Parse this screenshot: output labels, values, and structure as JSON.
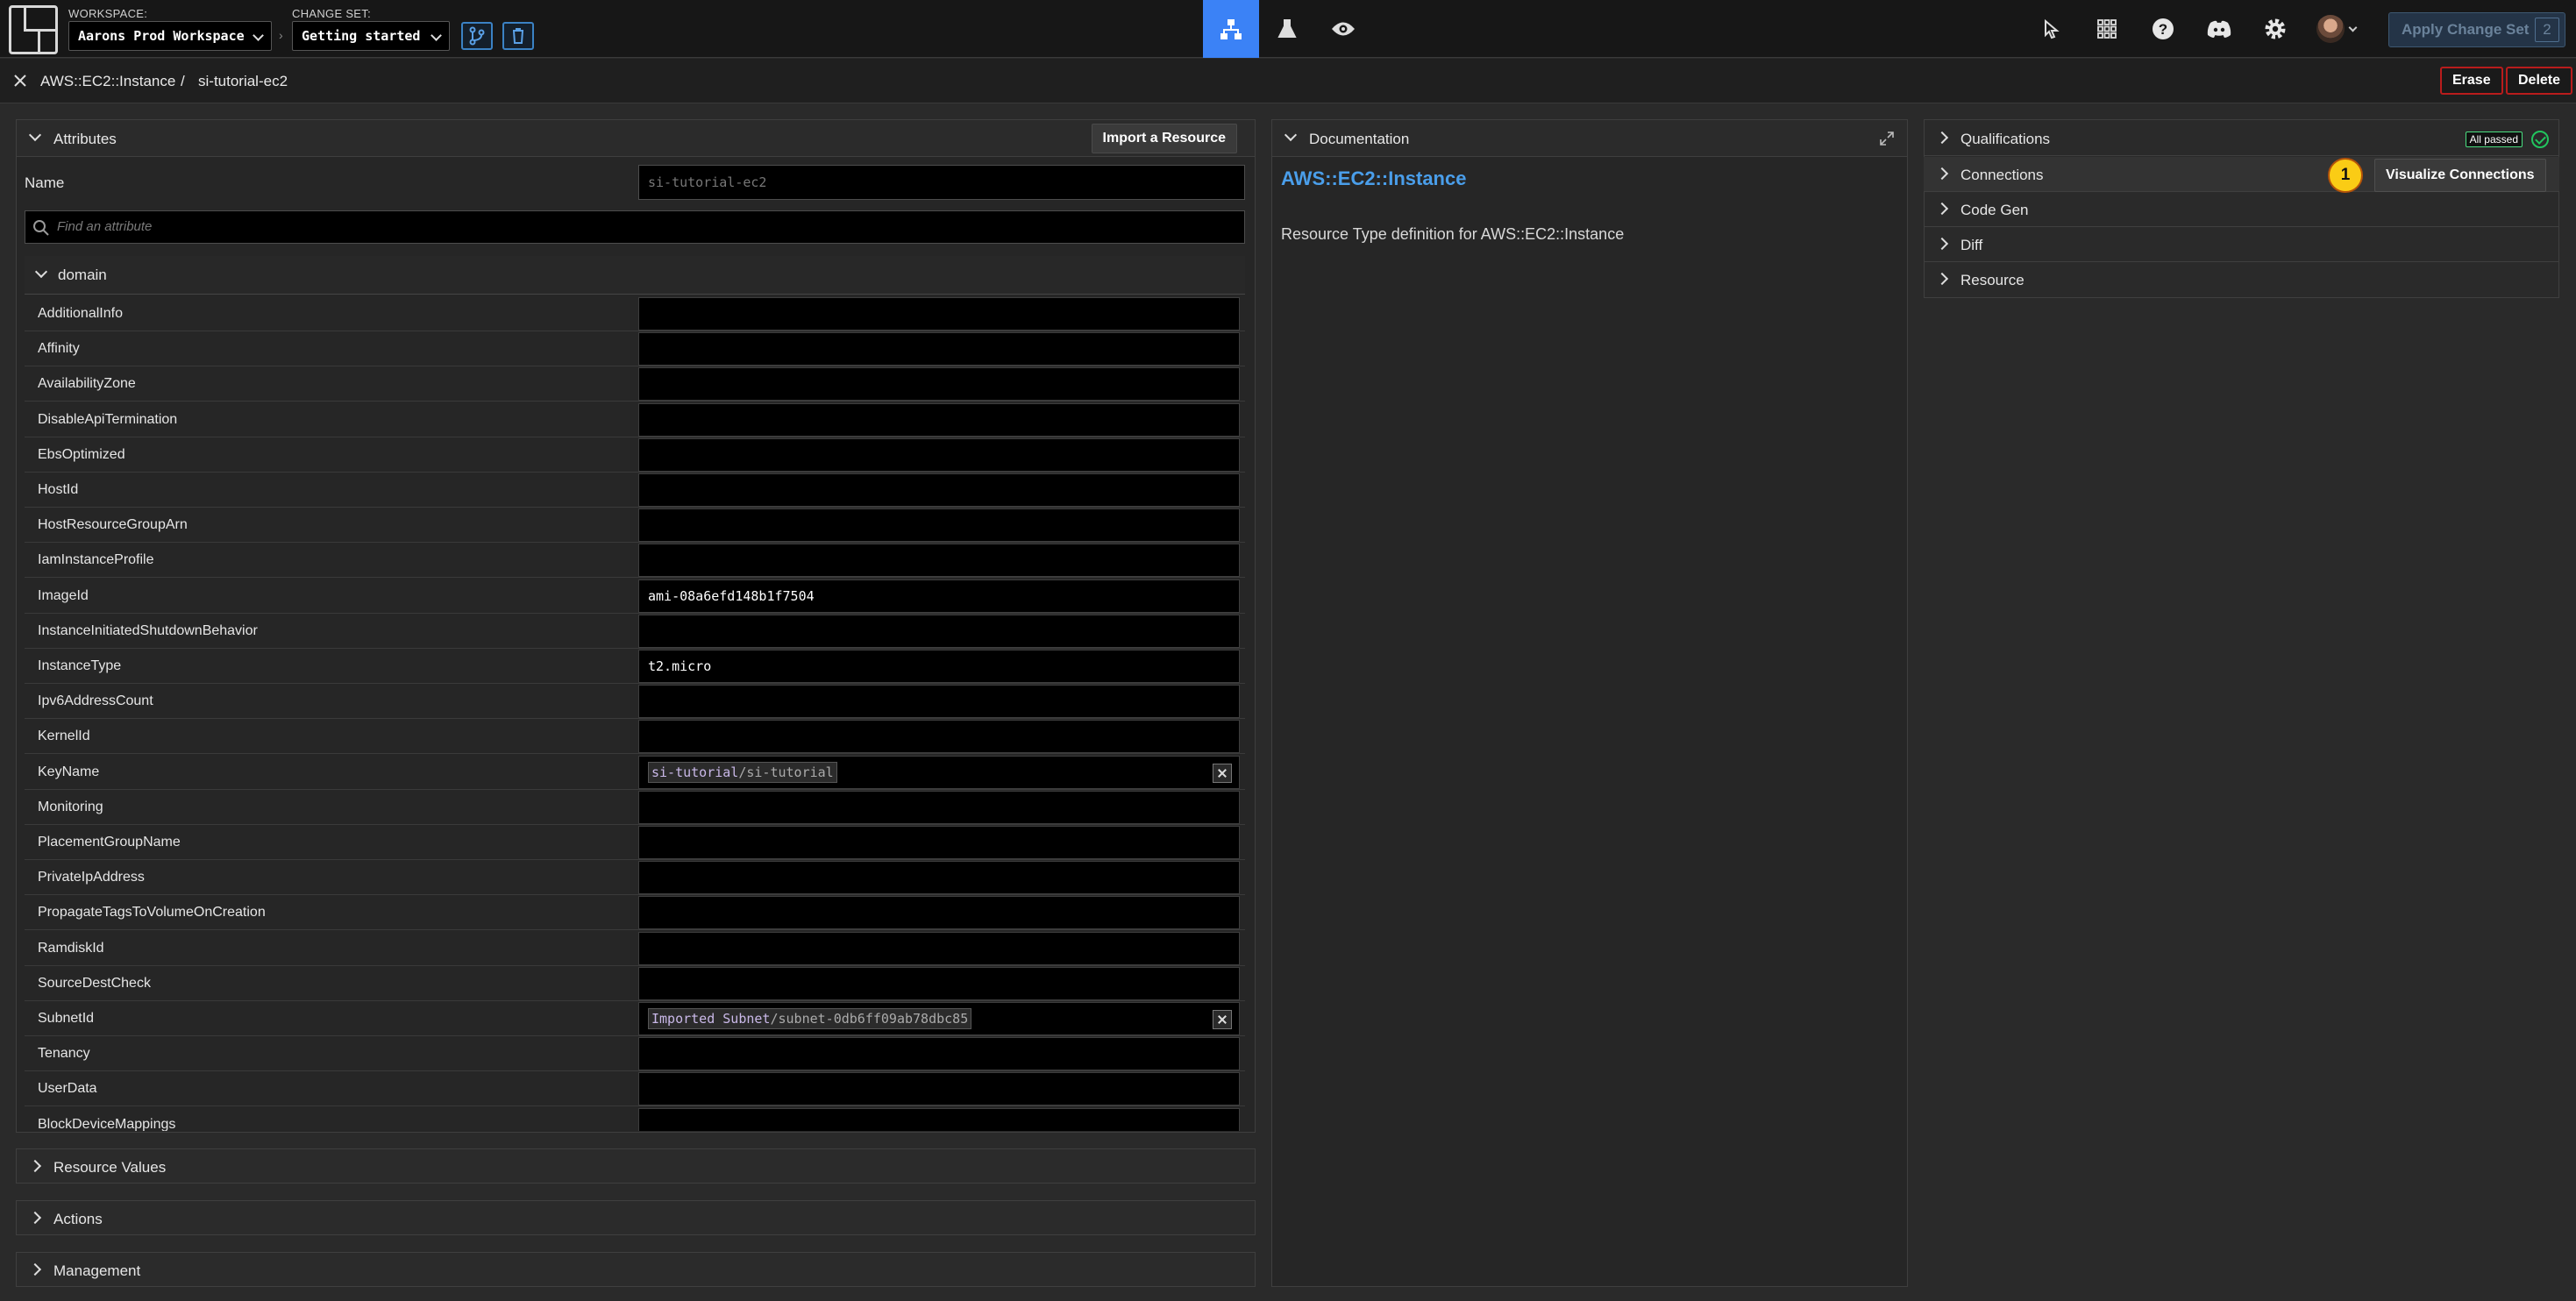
{
  "topbar": {
    "workspace_label": "WORKSPACE:",
    "workspace_value": "Aarons Prod Workspace",
    "changeset_label": "CHANGE SET:",
    "changeset_value": "Getting started",
    "apply_label": "Apply Change Set",
    "apply_count": "2"
  },
  "breadcrumb": {
    "schema": "AWS::EC2::Instance",
    "separator": "/",
    "component": "si-tutorial-ec2"
  },
  "actions": {
    "erase": "Erase",
    "delete": "Delete"
  },
  "attributes_panel": {
    "title": "Attributes",
    "import_button": "Import a Resource",
    "name_label": "Name",
    "name_value": "si-tutorial-ec2",
    "find_placeholder": "Find an attribute",
    "domain_label": "domain",
    "rows": [
      {
        "key": "AdditionalInfo",
        "value": ""
      },
      {
        "key": "Affinity",
        "value": ""
      },
      {
        "key": "AvailabilityZone",
        "value": ""
      },
      {
        "key": "DisableApiTermination",
        "value": ""
      },
      {
        "key": "EbsOptimized",
        "value": ""
      },
      {
        "key": "HostId",
        "value": ""
      },
      {
        "key": "HostResourceGroupArn",
        "value": ""
      },
      {
        "key": "IamInstanceProfile",
        "value": ""
      },
      {
        "key": "ImageId",
        "value": "ami-08a6efd148b1f7504"
      },
      {
        "key": "InstanceInitiatedShutdownBehavior",
        "value": ""
      },
      {
        "key": "InstanceType",
        "value": "t2.micro"
      },
      {
        "key": "Ipv6AddressCount",
        "value": ""
      },
      {
        "key": "KernelId",
        "value": ""
      },
      {
        "key": "KeyName",
        "chip_a": "si-tutorial",
        "chip_b": "/si-tutorial"
      },
      {
        "key": "Monitoring",
        "value": ""
      },
      {
        "key": "PlacementGroupName",
        "value": ""
      },
      {
        "key": "PrivateIpAddress",
        "value": ""
      },
      {
        "key": "PropagateTagsToVolumeOnCreation",
        "value": ""
      },
      {
        "key": "RamdiskId",
        "value": ""
      },
      {
        "key": "SourceDestCheck",
        "value": ""
      },
      {
        "key": "SubnetId",
        "chip_a": "Imported Subnet",
        "chip_b": "/subnet-0db6ff09ab78dbc85"
      },
      {
        "key": "Tenancy",
        "value": ""
      },
      {
        "key": "UserData",
        "value": ""
      },
      {
        "key": "BlockDeviceMappings",
        "value": ""
      }
    ]
  },
  "lower_sections": [
    "Resource Values",
    "Actions",
    "Management"
  ],
  "documentation": {
    "title": "Documentation",
    "heading": "AWS::EC2::Instance",
    "body": "Resource Type definition for AWS::EC2::Instance"
  },
  "right_panel": {
    "sections": [
      "Qualifications",
      "Connections",
      "Code Gen",
      "Diff",
      "Resource"
    ],
    "qual_badge": "All passed",
    "connections_count": "1",
    "visualize_button": "Visualize Connections"
  },
  "colors": {
    "accent": "#3b82f6",
    "danger": "#b91c1c",
    "success": "#22c55e",
    "link": "#4a9eea"
  }
}
